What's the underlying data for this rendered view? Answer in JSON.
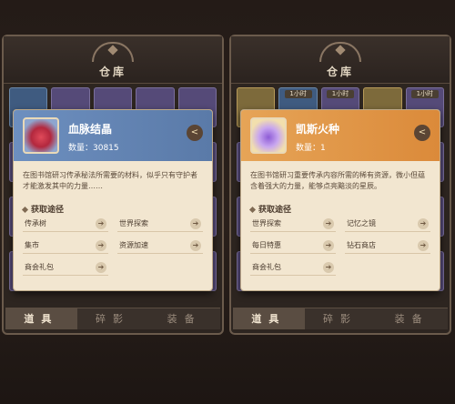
{
  "left_panel": {
    "title": "仓库",
    "tabs": [
      "道具",
      "碎影",
      "装备"
    ],
    "badges": []
  },
  "right_panel": {
    "title": "仓库",
    "tabs": [
      "道具",
      "碎影",
      "装备"
    ],
    "badges": [
      "1小时",
      "1小时",
      "1小时"
    ]
  },
  "left_card": {
    "name": "血脉结晶",
    "quantity": "数量：30815",
    "description": "在图书馆研习传承秘法所需要的材料，似乎只有守护者才能激发其中的力量……",
    "source_title": "获取途径",
    "sources": [
      "传承树",
      "世界探索",
      "集市",
      "资源加速",
      "商会礼包"
    ],
    "colors": {
      "header": "#6d8fbf"
    }
  },
  "right_card": {
    "name": "凯斯火种",
    "quantity": "数量：1",
    "description": "在图书馆研习重要传承内容所需的稀有资源，微小但蕴含着强大的力量，能够点亮黯淡的星辰。",
    "source_title": "获取途径",
    "sources": [
      "世界探索",
      "记忆之镜",
      "每日特惠",
      "钻石商店",
      "商会礼包"
    ],
    "colors": {
      "header": "#e6a457"
    }
  }
}
